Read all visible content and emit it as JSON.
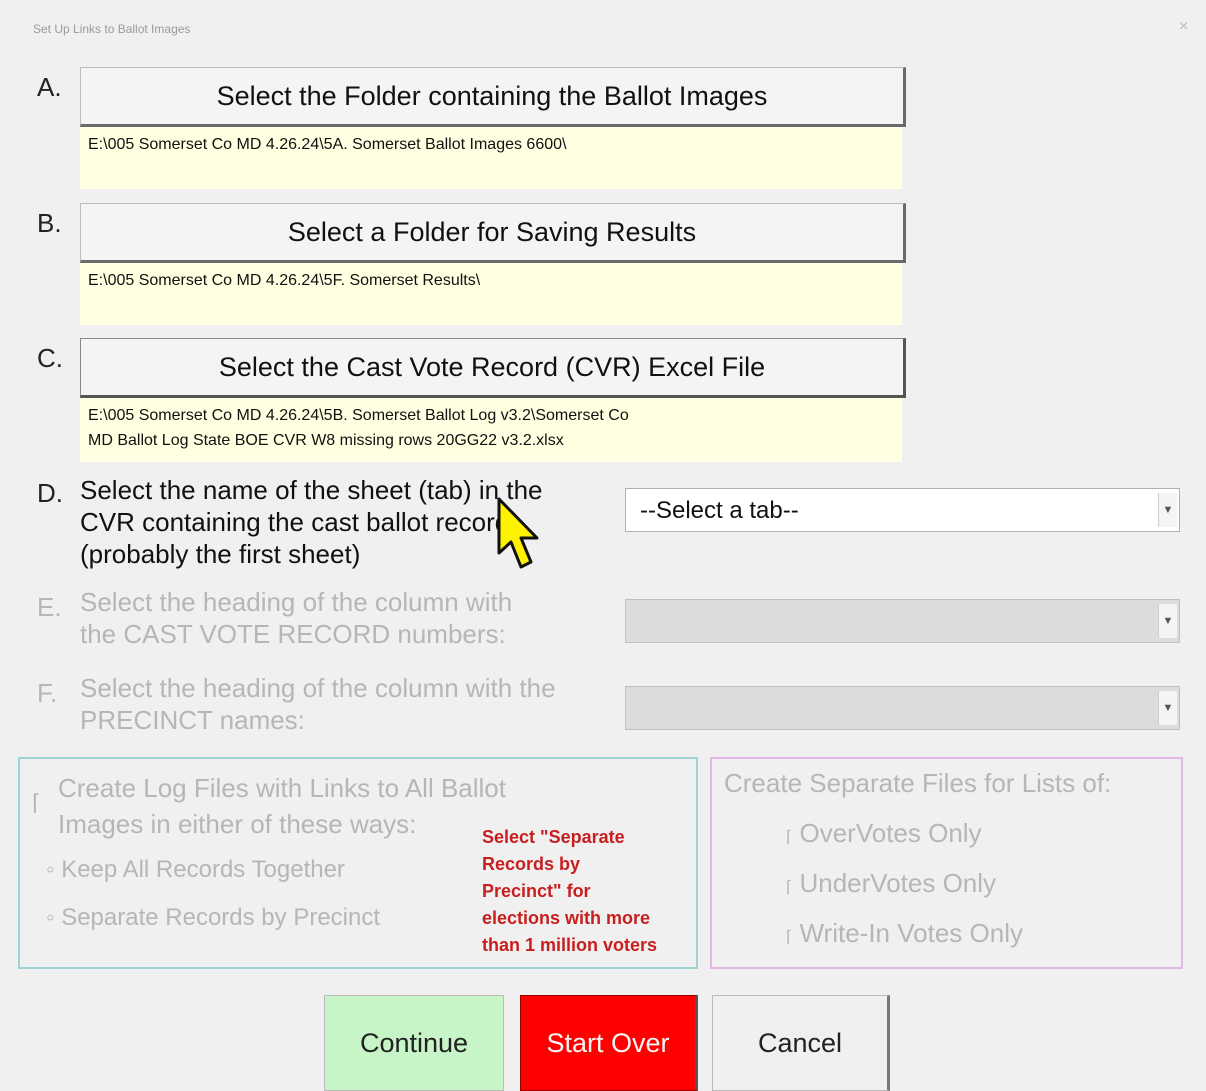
{
  "window": {
    "title": "Set Up Links to Ballot Images",
    "close_label": "×"
  },
  "steps": {
    "a": {
      "letter": "A.",
      "button_label": "Select the Folder containing the Ballot Images",
      "path": "E:\\005 Somerset Co MD 4.26.24\\5A. Somerset Ballot Images 6600\\"
    },
    "b": {
      "letter": "B.",
      "button_label": "Select a Folder for Saving Results",
      "path": "E:\\005 Somerset Co MD 4.26.24\\5F. Somerset Results\\"
    },
    "c": {
      "letter": "C.",
      "button_label": "Select the Cast Vote Record (CVR) Excel File",
      "path_line1": "E:\\005 Somerset Co MD 4.26.24\\5B. Somerset Ballot Log v3.2\\Somerset Co",
      "path_line2": "MD Ballot Log  State BOE CVR W8 missing rows 20GG22 v3.2.xlsx"
    },
    "d": {
      "letter": "D.",
      "line1": "Select the name of the sheet (tab) in the",
      "line2": "CVR containing the cast ballot records",
      "line3": "(probably the first sheet)",
      "combo_value": "--Select a tab--"
    },
    "e": {
      "letter": "E.",
      "line1": "Select the heading of the column with",
      "line2": "the CAST VOTE RECORD numbers:"
    },
    "f": {
      "letter": "F.",
      "line1": "Select the heading of the column with the",
      "line2": "PRECINCT names:"
    }
  },
  "log_options": {
    "line1": "Create Log Files with Links to All Ballot",
    "line2": "Images in either of these ways:",
    "radio1": "Keep All Records Together",
    "radio2": "Separate Records by Precinct",
    "note_lines": [
      "Select \"Separate",
      "Records by",
      "Precinct\" for",
      "elections with more",
      "than 1 million voters"
    ]
  },
  "separate_files": {
    "heading": "Create Separate Files for Lists of:",
    "opt1": "OverVotes Only",
    "opt2": "UnderVotes Only",
    "opt3": "Write-In Votes Only"
  },
  "buttons": {
    "continue": "Continue",
    "start_over": "Start Over",
    "cancel": "Cancel"
  },
  "icons": {
    "dropdown": "dropdown-arrow-icon",
    "cursor": "mouse-pointer-icon"
  }
}
